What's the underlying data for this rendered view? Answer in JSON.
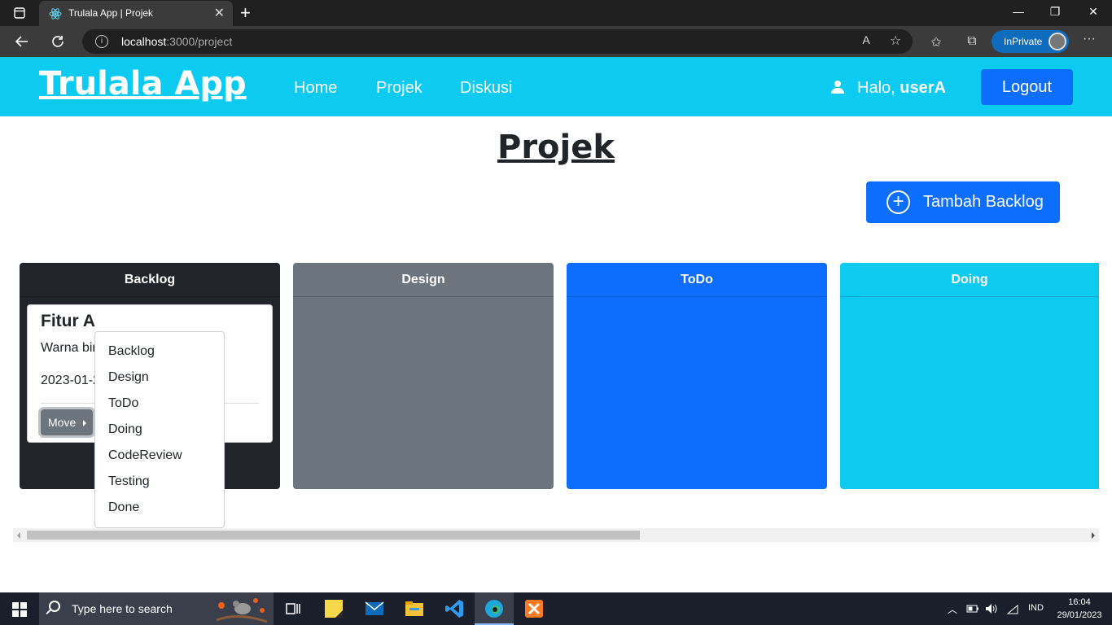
{
  "browser": {
    "tab_title": "Trulala App | Projek",
    "tab_close": "✕",
    "new_tab": "+",
    "url_host": "localhost",
    "url_path": ":3000/project",
    "inprivate_label": "InPrivate",
    "window_controls": {
      "minimize": "—",
      "restore": "❐",
      "close": "✕"
    },
    "toolbar_icons": [
      "back-icon",
      "refresh-icon",
      "read-aloud-icon",
      "favorite-add-icon",
      "favorites-icon",
      "collections-icon",
      "more-icon"
    ]
  },
  "navbar": {
    "brand": "Trulala App",
    "links": [
      "Home",
      "Projek",
      "Diskusi"
    ],
    "greeting_prefix": "Halo, ",
    "username": "userA",
    "logout_label": "Logout"
  },
  "page": {
    "title": "Projek",
    "add_button_label": "Tambah Backlog"
  },
  "board": {
    "columns": [
      {
        "name": "Backlog",
        "color": "#212529"
      },
      {
        "name": "Design",
        "color": "#6c757d"
      },
      {
        "name": "ToDo",
        "color": "#0d6efd"
      },
      {
        "name": "Doing",
        "color": "#0dcaf0"
      }
    ],
    "card": {
      "title": "Fitur A",
      "description": "Warna bir",
      "date": "2023-01-2",
      "move_label": "Move"
    },
    "move_menu": [
      "Backlog",
      "Design",
      "ToDo",
      "Doing",
      "CodeReview",
      "Testing",
      "Done"
    ]
  },
  "taskbar": {
    "search_placeholder": "Type here to search",
    "language": "IND",
    "time": "16:04",
    "date": "29/01/2023",
    "apps": [
      "task-view-icon",
      "sticky-notes-icon",
      "mail-icon",
      "file-explorer-icon",
      "vscode-icon",
      "edge-icon",
      "xampp-icon"
    ]
  },
  "colors": {
    "navbar": "#0dcaf0",
    "primary": "#0d6efd",
    "dark": "#212529",
    "secondary": "#6c757d"
  }
}
